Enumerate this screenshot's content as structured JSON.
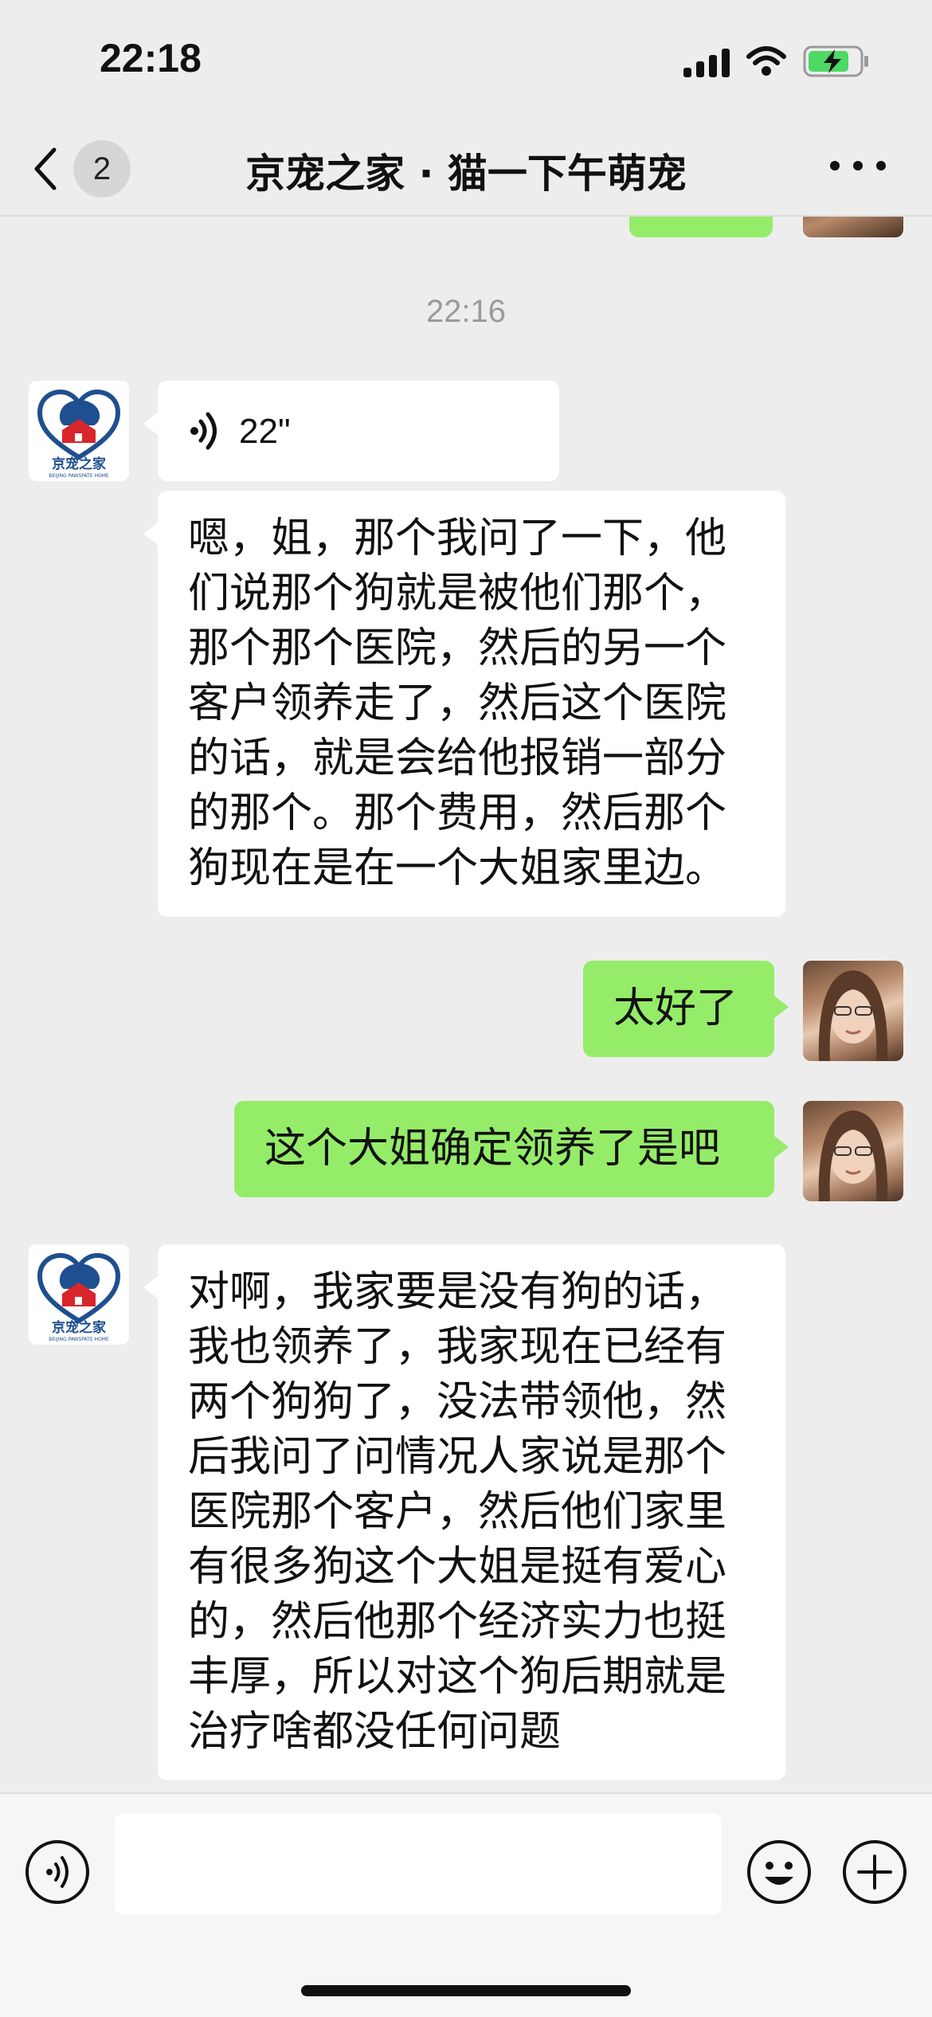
{
  "status_bar": {
    "time": "22:18"
  },
  "header": {
    "unread_count": "2",
    "title": "京宠之家 · 猫一下午萌宠"
  },
  "chat": {
    "timestamp": "22:16",
    "org_logo_text": "京宠之家",
    "org_logo_subtext": "BEIJING PAWSPATE HOME",
    "messages": [
      {
        "sender": "京宠之家",
        "type": "voice",
        "duration": "22\""
      },
      {
        "sender": "京宠之家",
        "type": "text",
        "text": "嗯，姐，那个我问了一下，他们说那个狗就是被他们那个，那个那个医院，然后的另一个客户领养走了，然后这个医院的话，就是会给他报销一部分的那个。那个费用，然后那个狗现在是在一个大姐家里边。"
      },
      {
        "sender": "me",
        "type": "text",
        "text": "太好了"
      },
      {
        "sender": "me",
        "type": "text",
        "text": "这个大姐确定领养了是吧"
      },
      {
        "sender": "京宠之家",
        "type": "text",
        "text": "对啊，我家要是没有狗的话，我也领养了，我家现在已经有两个狗狗了，没法带领他，然后我问了问情况人家说是那个医院那个客户，然后他们家里有很多狗这个大姐是挺有爱心的，然后他那个经济实力也挺丰厚，所以对这个狗后期就是治疗啥都没任何问题"
      }
    ]
  },
  "colors": {
    "background": "#ededed",
    "outgoing_bubble": "#95ec69",
    "incoming_bubble": "#ffffff",
    "battery_fill": "#4cd964"
  },
  "icons": [
    "back-chevron-icon",
    "more-icon",
    "voice-icon",
    "emoji-icon",
    "plus-icon",
    "signal-icon",
    "wifi-icon",
    "battery-icon"
  ]
}
